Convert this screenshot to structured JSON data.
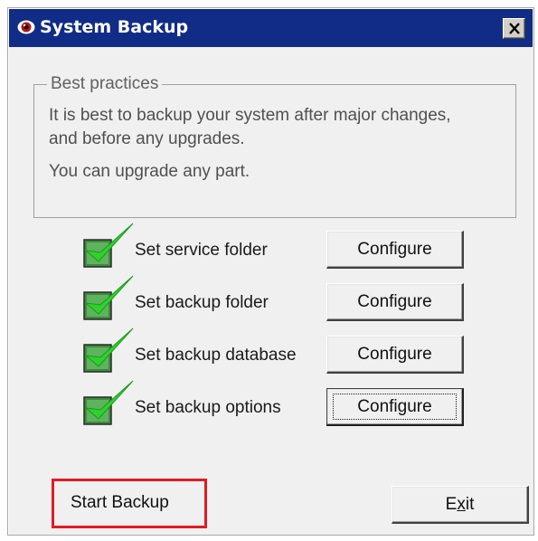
{
  "window": {
    "title": "System Backup",
    "title_icon": "eye-icon",
    "close_icon": "close-icon",
    "titlebar_color": "#102c86"
  },
  "best_practices": {
    "legend": "Best practices",
    "line1": "It is best to backup your system after major changes,",
    "line2": "and before any upgrades.",
    "line3": "You can upgrade any part."
  },
  "tasks": [
    {
      "label": "Set service folder",
      "button": "Configure",
      "checked": true,
      "icon": "checkmark-icon"
    },
    {
      "label": "Set backup folder",
      "button": "Configure",
      "checked": true,
      "icon": "checkmark-icon"
    },
    {
      "label": "Set backup database",
      "button": "Configure",
      "checked": true,
      "icon": "checkmark-icon"
    },
    {
      "label": "Set backup options",
      "button": "Configure",
      "checked": true,
      "icon": "checkmark-icon"
    }
  ],
  "footer": {
    "start_backup_label": "Start Backup",
    "exit_prefix": "E",
    "exit_mnemonic": "x",
    "exit_suffix": "it",
    "highlight_color": "#e01b24"
  }
}
